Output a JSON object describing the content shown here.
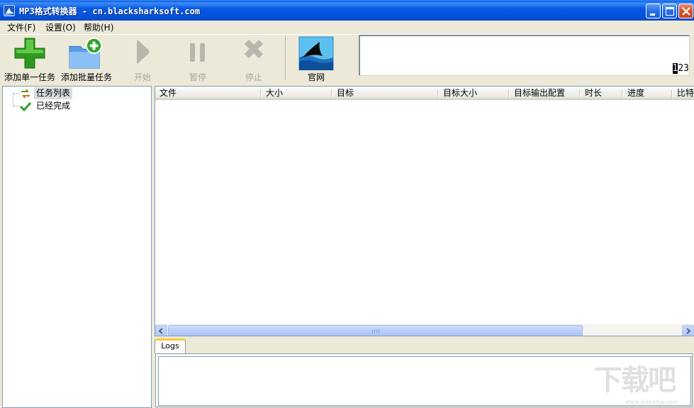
{
  "window": {
    "title": "MP3格式转换器 - cn.blacksharksoft.com",
    "controls": {
      "minimize": "minimize-icon",
      "maximize": "maximize-icon",
      "close": "close-icon"
    }
  },
  "menu": [
    {
      "label": "文件(F)"
    },
    {
      "label": "设置(O)"
    },
    {
      "label": "帮助(H)"
    }
  ],
  "toolbar": {
    "add_single": {
      "label": "添加单一任务",
      "icon": "add-plus-icon",
      "enabled": true
    },
    "add_batch": {
      "label": "添加批量任务",
      "icon": "folder-add-icon",
      "enabled": true
    },
    "start": {
      "label": "开始",
      "icon": "play-icon",
      "enabled": false
    },
    "pause": {
      "label": "暂停",
      "icon": "pause-icon",
      "enabled": false
    },
    "stop": {
      "label": "停止",
      "icon": "stop-x-icon",
      "enabled": false
    },
    "site": {
      "label": "官网",
      "icon": "shark-logo-icon",
      "enabled": true
    }
  },
  "progress": {
    "highlight": "1",
    "rest": "23"
  },
  "tree": {
    "items": [
      {
        "label": "任务列表",
        "icon": "task-list-icon",
        "selected": true
      },
      {
        "label": "已经完成",
        "icon": "checkmark-icon",
        "selected": false
      }
    ]
  },
  "list": {
    "columns": [
      "文件",
      "大小",
      "目标",
      "目标大小",
      "目标输出配置",
      "时长",
      "进度",
      "比特"
    ],
    "rows": []
  },
  "logs": {
    "tab_label": "Logs",
    "content": ""
  },
  "watermark": {
    "text": "下载吧",
    "sub": "www.xiazaiba.com"
  },
  "colors": {
    "title_bar": "#0858e0",
    "face": "#ece9d8",
    "border": "#7f9db9"
  }
}
